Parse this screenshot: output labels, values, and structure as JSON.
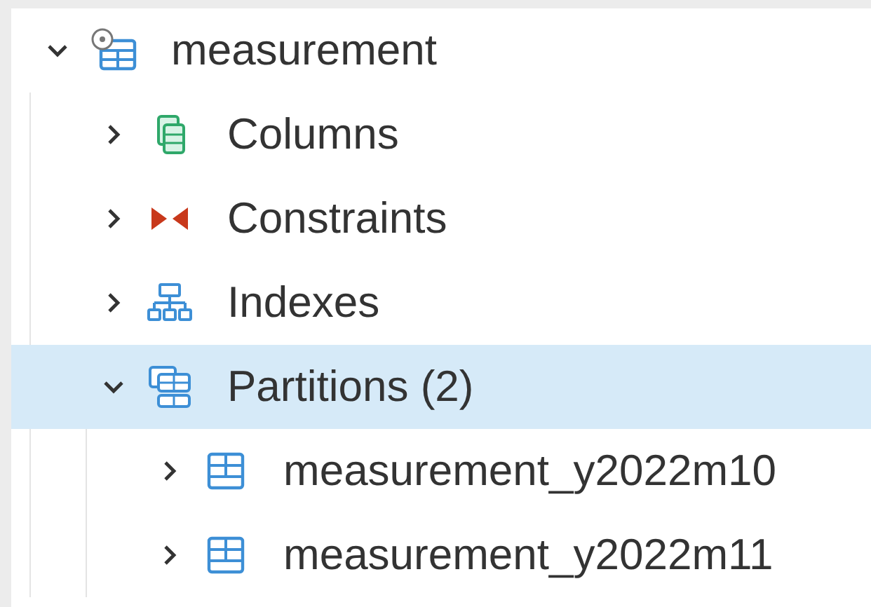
{
  "tree": [
    {
      "label": "measurement",
      "kind": "partitioned-table",
      "expanded": true,
      "selected": false,
      "children": [
        {
          "label": "Columns",
          "kind": "columns",
          "expanded": false,
          "selected": false
        },
        {
          "label": "Constraints",
          "kind": "constraints",
          "expanded": false,
          "selected": false
        },
        {
          "label": "Indexes",
          "kind": "indexes",
          "expanded": false,
          "selected": false
        },
        {
          "label": "Partitions (2)",
          "kind": "partitions",
          "expanded": true,
          "selected": true,
          "children": [
            {
              "label": "measurement_y2022m10",
              "kind": "table",
              "expanded": false,
              "selected": false
            },
            {
              "label": "measurement_y2022m11",
              "kind": "table",
              "expanded": false,
              "selected": false
            }
          ]
        }
      ]
    }
  ]
}
